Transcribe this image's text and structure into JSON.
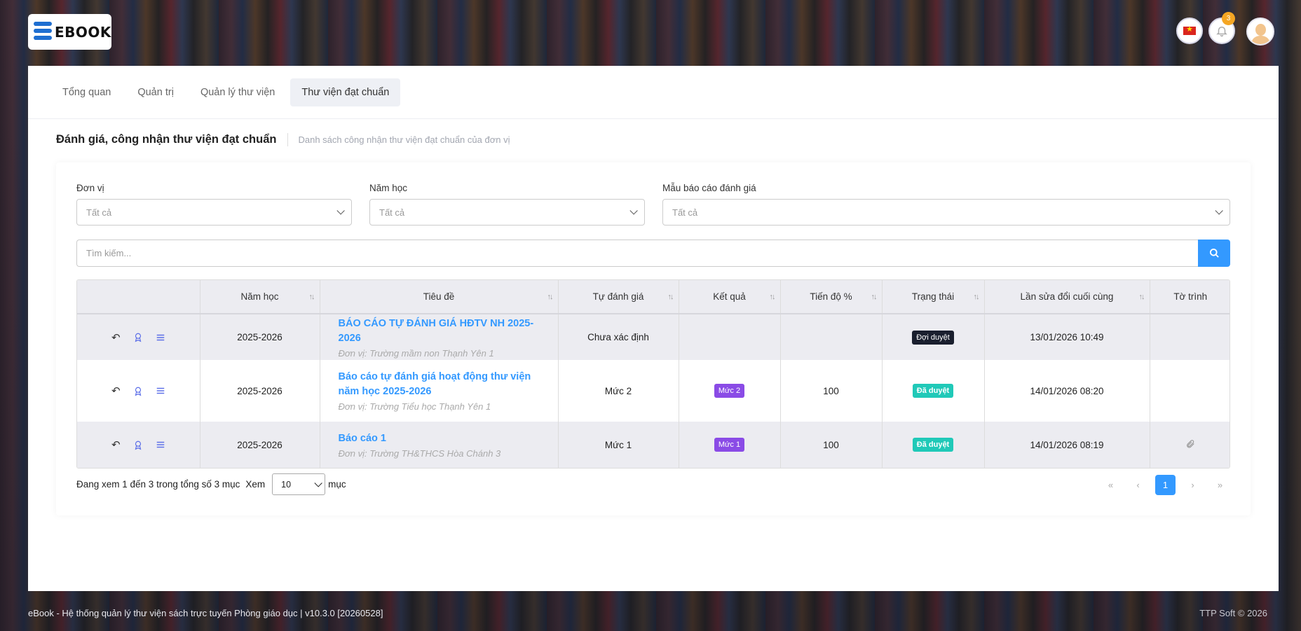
{
  "header": {
    "logo_text": "EBOOK",
    "notification_count": "3",
    "icons": [
      "vn-flag-icon",
      "bell-icon",
      "avatar"
    ]
  },
  "tabs": [
    {
      "label": "Tổng quan"
    },
    {
      "label": "Quản trị"
    },
    {
      "label": "Quản lý thư viện"
    },
    {
      "label": "Thư viện đạt chuẩn"
    }
  ],
  "page": {
    "title": "Đánh giá, công nhận thư viện đạt chuẩn",
    "subtitle": "Danh sách công nhận thư viện đạt chuẩn của đơn vị"
  },
  "filters": {
    "unit": {
      "label": "Đơn vị",
      "value": "Tất cả"
    },
    "year": {
      "label": "Năm học",
      "value": "Tất cả"
    },
    "template": {
      "label": "Mẫu báo cáo đánh giá",
      "value": "Tất cả"
    }
  },
  "search": {
    "placeholder": "Tìm kiếm..."
  },
  "table": {
    "headers": [
      "Năm học",
      "Tiêu đề",
      "Tự đánh giá",
      "Kết quả",
      "Tiến độ %",
      "Trạng thái",
      "Lần sửa đổi cuối cùng",
      "Tờ trình"
    ],
    "rows": [
      {
        "year": "2025-2026",
        "title": "BÁO CÁO TỰ ĐÁNH GIÁ HĐTV NH 2025-2026",
        "unit": "Đơn vị: Trường mầm non Thạnh Yên 1",
        "self_eval": "Chưa xác định",
        "result": "",
        "progress": "",
        "status": "Đợi duyệt",
        "modified": "13/01/2026 10:49"
      },
      {
        "year": "2025-2026",
        "title": "Báo cáo tự đánh giá hoạt động thư viện năm học 2025-2026",
        "unit": "Đơn vị: Trường Tiểu học Thạnh Yên 1",
        "self_eval": "Mức 2",
        "result": "Mức 2",
        "progress": "100",
        "status": "Đã duyệt",
        "modified": "14/01/2026 08:20"
      },
      {
        "year": "2025-2026",
        "title": "Báo cáo 1",
        "unit": "Đơn vị: Trường TH&THCS Hòa Chánh 3",
        "self_eval": "Mức 1",
        "result": "Mức 1",
        "progress": "100",
        "status": "Đã duyệt",
        "modified": "14/01/2026 08:19"
      }
    ]
  },
  "pagination": {
    "info": "Đang xem 1 đến 3 trong tổng số 3 mục",
    "show_label": "Xem",
    "per_page": "10",
    "unit_label": "mục",
    "first": "«",
    "prev": "‹",
    "current": "1",
    "next": "›",
    "last": "»"
  },
  "footer": {
    "left": "eBook - Hệ thống quản lý thư viện sách trực tuyến Phòng giáo dục | v10.3.0 [20260528]",
    "right": "TTP Soft © 2026"
  },
  "colors": {
    "accent": "#3399ff",
    "teal": "#20c9b8",
    "purple": "#8a4be6",
    "dark": "#1a1f2e"
  }
}
